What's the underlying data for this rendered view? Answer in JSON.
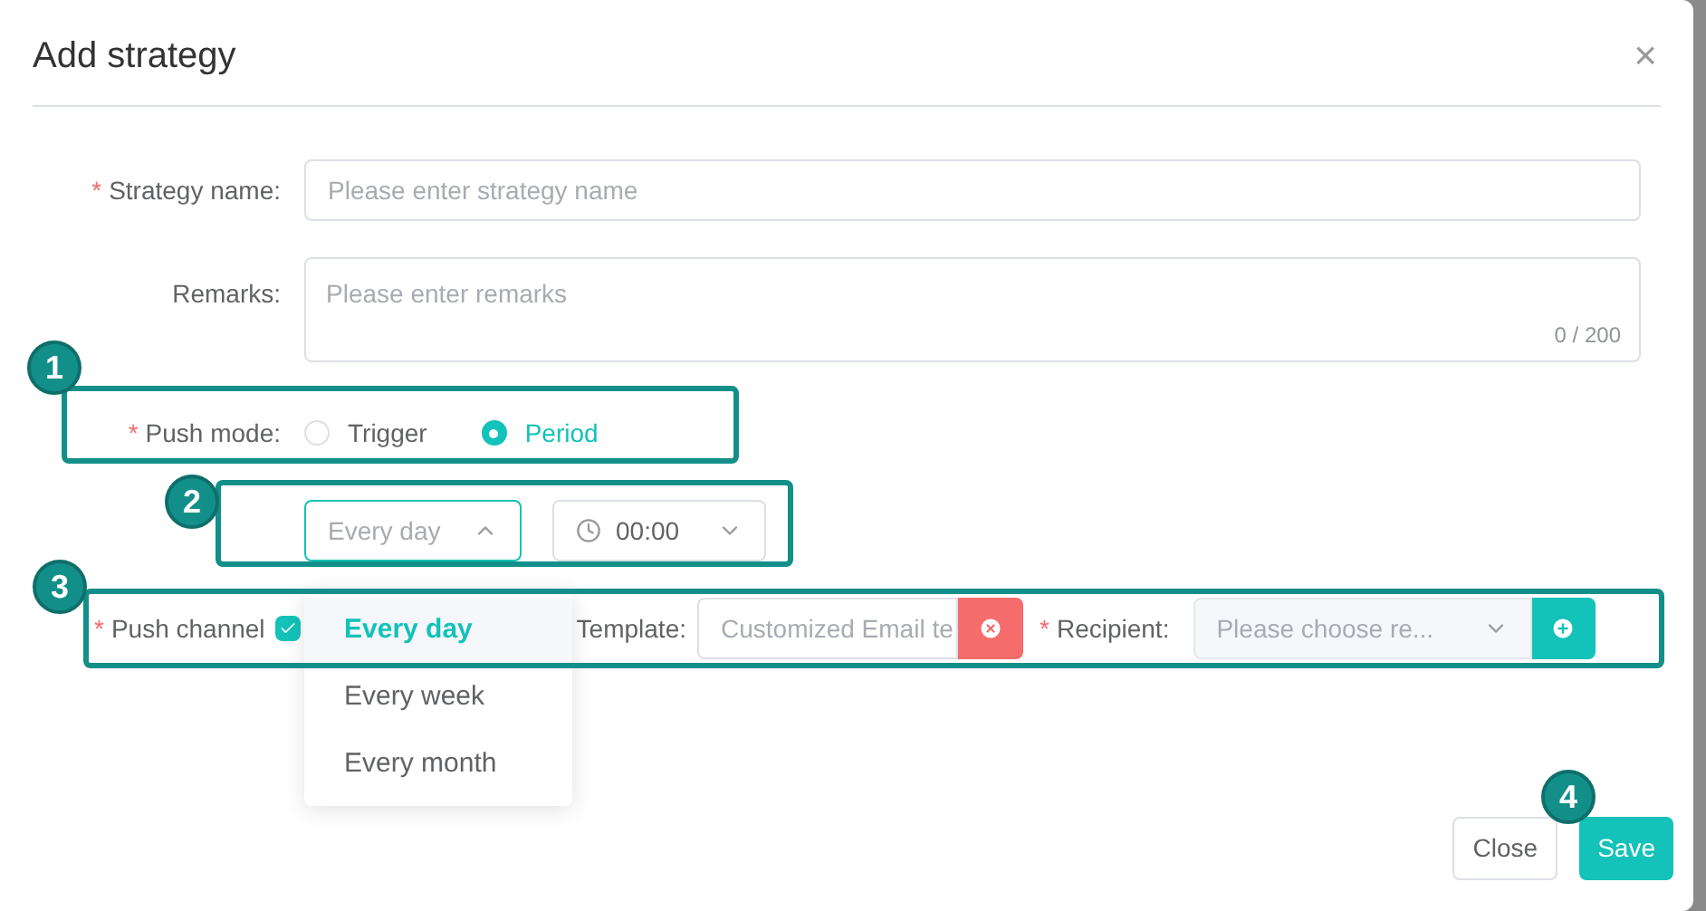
{
  "dialog": {
    "title": "Add strategy",
    "close_icon": "×"
  },
  "fields": {
    "strategy_name": {
      "label": "Strategy name:",
      "required_mark": "*",
      "placeholder": "Please enter strategy name"
    },
    "remarks": {
      "label": "Remarks:",
      "placeholder": "Please enter remarks",
      "counter": "0 / 200"
    },
    "push_mode": {
      "label": "Push mode:",
      "required_mark": "*",
      "options": [
        {
          "label": "Trigger",
          "selected": false
        },
        {
          "label": "Period",
          "selected": true
        }
      ]
    },
    "period": {
      "value": "Every day",
      "expanded": true,
      "time": "00:00",
      "options": [
        {
          "label": "Every day",
          "selected": true
        },
        {
          "label": "Every week",
          "selected": false
        },
        {
          "label": "Every month",
          "selected": false
        }
      ]
    },
    "push_channel": {
      "label": "Push channel",
      "required_mark": "*",
      "checked": true,
      "template_label": "Template:",
      "template_value": "Customized Email te",
      "recipient_label": "Recipient:",
      "recipient_required_mark": "*",
      "recipient_placeholder": "Please choose re..."
    }
  },
  "callouts": [
    "1",
    "2",
    "3",
    "4"
  ],
  "buttons": [
    {
      "label": "Close",
      "kind": "secondary"
    },
    {
      "label": "Save",
      "kind": "primary"
    }
  ]
}
